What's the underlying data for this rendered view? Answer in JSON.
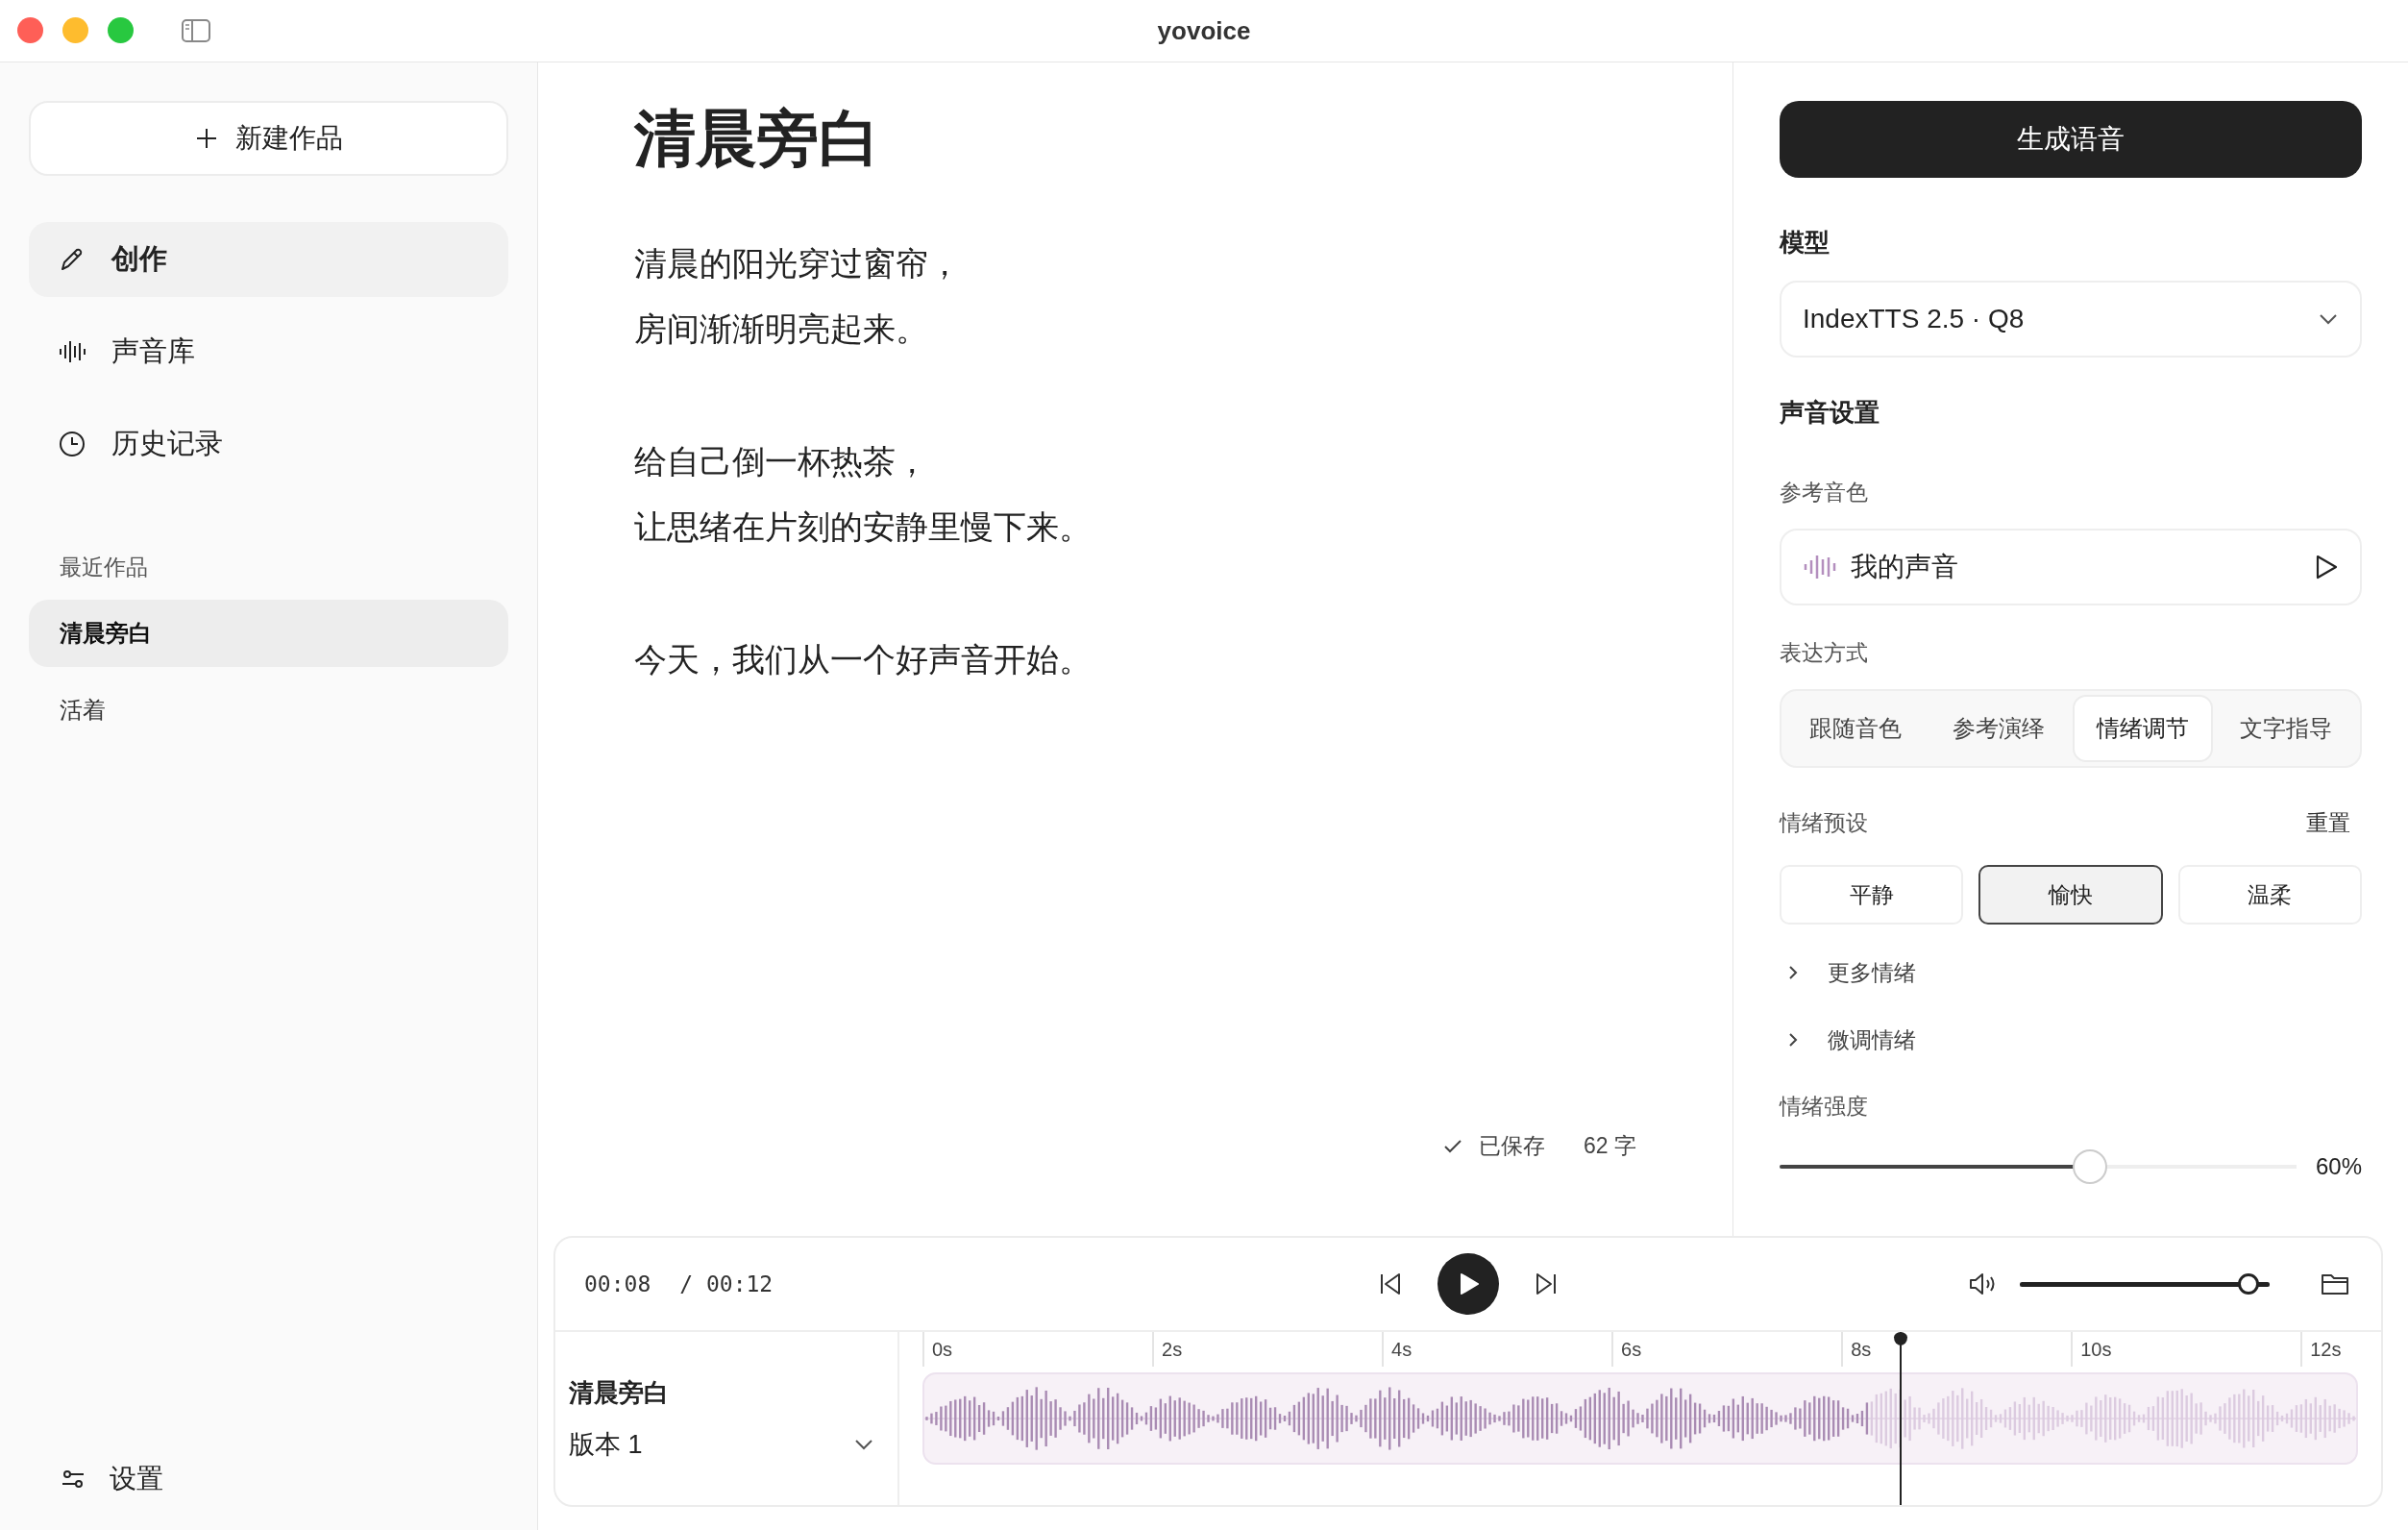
{
  "window": {
    "title": "yovoice"
  },
  "sidebar": {
    "new_button": "新建作品",
    "nav": [
      {
        "label": "创作",
        "selected": true
      },
      {
        "label": "声音库",
        "selected": false
      },
      {
        "label": "历史记录",
        "selected": false
      }
    ],
    "recent_heading": "最近作品",
    "recent": [
      {
        "label": "清晨旁白",
        "selected": true
      },
      {
        "label": "活着",
        "selected": false
      }
    ],
    "settings": "设置"
  },
  "editor": {
    "title": "清晨旁白",
    "paragraphs": [
      [
        "清晨的阳光穿过窗帘，",
        "房间渐渐明亮起来。"
      ],
      [
        "给自己倒一杯热茶，",
        "让思绪在片刻的安静里慢下来。"
      ],
      [
        "今天，我们从一个好声音开始。"
      ]
    ],
    "saved": "已保存",
    "count": "62 字"
  },
  "panel": {
    "generate": "生成语音",
    "model_label": "模型",
    "model": "IndexTTS 2.5 · Q8",
    "voice_heading": "声音设置",
    "ref_label": "参考音色",
    "ref_voice": "我的声音",
    "expr_label": "表达方式",
    "modes": [
      {
        "label": "跟随音色",
        "selected": false
      },
      {
        "label": "参考演绎",
        "selected": false
      },
      {
        "label": "情绪调节",
        "selected": true
      },
      {
        "label": "文字指导",
        "selected": false
      }
    ],
    "preset_label": "情绪预设",
    "reset": "重置",
    "presets": [
      {
        "label": "平静",
        "selected": false
      },
      {
        "label": "愉快",
        "selected": true
      },
      {
        "label": "温柔",
        "selected": false
      }
    ],
    "expanders": [
      {
        "label": "更多情绪",
        "expanded": false
      },
      {
        "label": "微调情绪",
        "expanded": false
      }
    ],
    "intensity_label": "情绪强度",
    "intensity": {
      "level": 0.6,
      "reading": "60%"
    }
  },
  "player": {
    "current": "00:08",
    "total": "/ 00:12",
    "volume": {
      "level": 1
    },
    "progress": {
      "level": 0.66
    },
    "track": "清晨旁白",
    "version": "版本 1",
    "ticks": [
      "0s",
      "2s",
      "4s",
      "6s",
      "8s",
      "10s",
      "12s"
    ]
  }
}
